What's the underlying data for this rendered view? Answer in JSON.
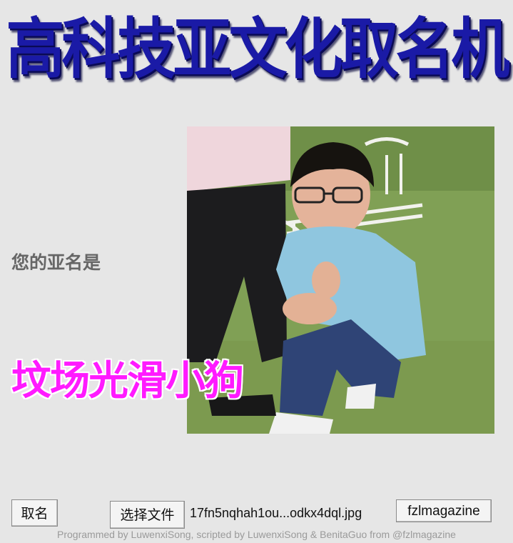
{
  "app": {
    "title": "高科技亚文化取名机"
  },
  "result": {
    "label": "您的亚名是",
    "name": "坟场光滑小狗"
  },
  "controls": {
    "name_button": "取名",
    "file_button": "选择文件",
    "file_name": "17fn5nqhah1ou...odkx4dql.jpg",
    "magazine_button": "fzlmagazine"
  },
  "footer": {
    "text": "Programmed by LuwenxiSong, scripted by LuwenxiSong & BenitaGuo from @fzlmagazine"
  },
  "colors": {
    "title": "#1a1aa6",
    "result_name": "#ff1aff",
    "result_label": "#666666",
    "background": "#e6e6e6"
  }
}
